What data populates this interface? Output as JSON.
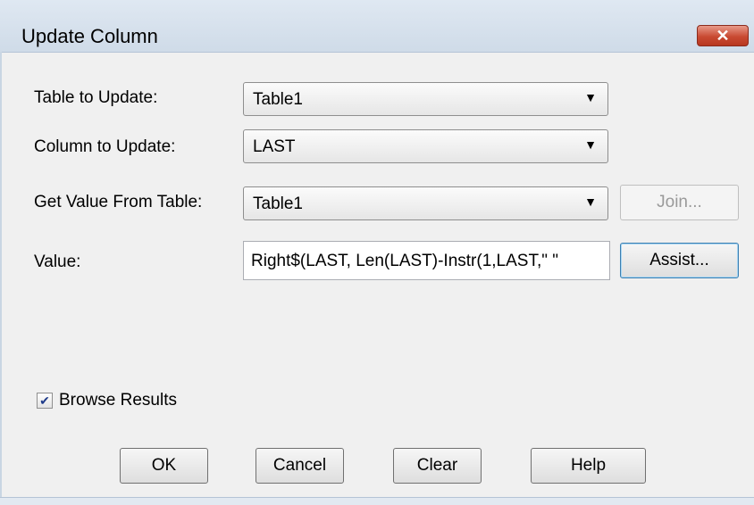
{
  "window": {
    "title": "Update Column",
    "close_glyph": "✕"
  },
  "fields": {
    "table_to_update": {
      "label": "Table to Update:",
      "value": "Table1"
    },
    "column_to_update": {
      "label": "Column to Update:",
      "value": "LAST"
    },
    "get_value_from_table": {
      "label": "Get Value From Table:",
      "value": "Table1"
    },
    "value": {
      "label": "Value:",
      "text": "Right$(LAST, Len(LAST)-Instr(1,LAST,\" \""
    }
  },
  "buttons": {
    "join": "Join...",
    "assist": "Assist...",
    "ok": "OK",
    "cancel": "Cancel",
    "clear": "Clear",
    "help": "Help"
  },
  "browse_results": {
    "label": "Browse Results",
    "checked": true,
    "glyph": "✔"
  },
  "arrow_glyph": "▼"
}
